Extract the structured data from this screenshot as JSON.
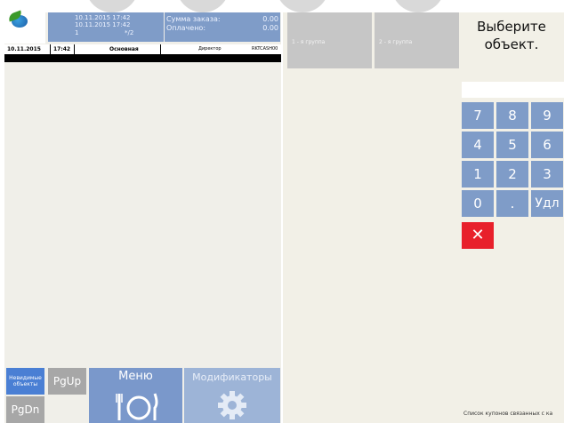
{
  "order_info": {
    "dt1": "10.11.2015 17:42",
    "dt2": "10.11.2015 17:42",
    "num": "1",
    "cnt": "*/2"
  },
  "sum_info": {
    "sum_label": "Сумма заказа:",
    "sum_value": "0.00",
    "paid_label": "Оплачено:",
    "paid_value": "0.00"
  },
  "info_bar": {
    "date": "10.11.2015",
    "time": "17:42",
    "hall": "Основная",
    "role": "Директор",
    "station": "RKTCASH00"
  },
  "groups": [
    "1 - я группа",
    "2 - я группа"
  ],
  "prompt_lines": [
    "Выберите",
    "объект."
  ],
  "keypad": [
    [
      "7",
      "8",
      "9"
    ],
    [
      "4",
      "5",
      "6"
    ],
    [
      "1",
      "2",
      "3"
    ],
    [
      "0",
      ".",
      "Удл"
    ]
  ],
  "clear_symbol": "✕",
  "buttons": {
    "objects_line1": "Невидимые",
    "objects_line2": "объекты",
    "pgup": "PgUp",
    "pgdn": "PgDn",
    "menu": "Меню",
    "modifiers": "Модификаторы"
  },
  "icons": {
    "menu": "plate-fork-icon",
    "modifiers": "gear-icon",
    "logo": "app-logo-icon"
  },
  "colors": {
    "accent_blue": "#7f9cc8",
    "objects_blue": "#4a7fd4",
    "group_gray": "#c6c6c6",
    "clear_red": "#e8202b"
  },
  "footer": {
    "coupons_text": "Список купонов связанных с ка"
  }
}
